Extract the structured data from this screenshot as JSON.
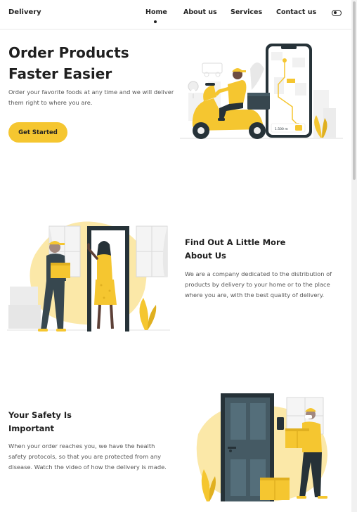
{
  "header": {
    "brand": "Delivery",
    "nav": [
      {
        "label": "Home",
        "active": true
      },
      {
        "label": "About us",
        "active": false
      },
      {
        "label": "Services",
        "active": false
      },
      {
        "label": "Contact us",
        "active": false
      }
    ],
    "theme_toggle_icon": "toggle-icon"
  },
  "hero": {
    "title_line1": "Order Products",
    "title_line2": "Faster Easier",
    "description": "Order your favorite foods at any time and we will deliver them right to where you are.",
    "cta_label": "Get Started",
    "phone_distance": "1.500 m"
  },
  "about": {
    "title_line1": "Find Out A Little More",
    "title_line2": "About Us",
    "description": "We are a company dedicated to the distribution of products by delivery to your home or to the place where you are, with the best quality of delivery."
  },
  "safety": {
    "title_line1": "Your Safety Is",
    "title_line2": "Important",
    "description": "When your order reaches you, we have the health safety protocols, so that you are protected from any disease. Watch the video of how the delivery is made."
  },
  "colors": {
    "accent": "#f5c630",
    "text_dark": "#1f1f1f",
    "text_muted": "#555555",
    "illustration_dark": "#37474f"
  }
}
